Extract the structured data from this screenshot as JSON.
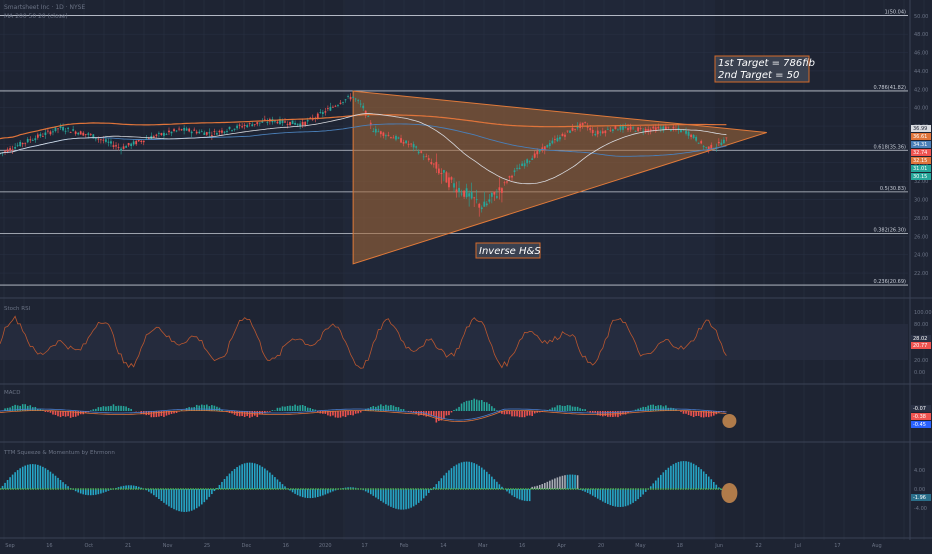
{
  "header": {
    "symbol_line": "Smartsheet Inc · 1D · NYSE",
    "ma_line": "MA 200 50 20 (close)"
  },
  "colors": {
    "background": "#1e2433",
    "grid": "#2a3245",
    "fib_line": "#c7ccd6",
    "triangle_fill": "#a86a36",
    "triangle_edge": "#e07a3a",
    "candle_up": "#26a69a",
    "candle_down": "#ef5350",
    "ma_orange": "#e0743a",
    "ma_white": "#d9dbe0",
    "ma_blue": "#4a7fb8",
    "annotation_border": "#d46a2a",
    "annotation_fill": "#3a4150",
    "highlight_circle": "#b07b4a"
  },
  "annotations": {
    "targets_line1": "1st Target = 786fib",
    "targets_line2": "2nd Target = 50",
    "pattern": "Inverse H&S"
  },
  "indicators": {
    "stoch_label": "Stoch RSI",
    "macd_label": "MACD",
    "ttm_label": "TTM Squeeze & Momentum by Ehrmonn"
  },
  "time_axis": [
    "Sep",
    "16",
    "Oct",
    "21",
    "Nov",
    "25",
    "Dec",
    "16",
    "2020",
    "17",
    "Feb",
    "14",
    "Mar",
    "16",
    "Apr",
    "20",
    "May",
    "18",
    "Jun",
    "22",
    "Jul",
    "17",
    "Aug"
  ],
  "chart_data": [
    {
      "type": "line",
      "title": "",
      "price_axis_ticks": [
        22,
        24,
        26,
        28,
        30,
        32,
        34,
        36,
        38,
        40,
        42,
        44,
        46,
        48,
        50,
        52
      ],
      "ylim": [
        19.5,
        51.5
      ],
      "fib_levels": [
        {
          "label": "1(50.04)",
          "value": 50.04
        },
        {
          "label": "0.786(41.82)",
          "value": 41.82
        },
        {
          "label": "0.618(35.36)",
          "value": 35.36
        },
        {
          "label": "0.5(30.83)",
          "value": 30.83
        },
        {
          "label": "0.382(26.30)",
          "value": 26.3
        },
        {
          "label": "0.236(20.69)",
          "value": 20.69
        }
      ],
      "price_badges": [
        "36.99",
        "36.61",
        "34.31",
        "32.74",
        "32.15",
        "31.01",
        "30.15"
      ],
      "price_path": [
        [
          0,
          35.0
        ],
        [
          6,
          36.5
        ],
        [
          12,
          37.8
        ],
        [
          18,
          37.0
        ],
        [
          24,
          35.6
        ],
        [
          30,
          36.8
        ],
        [
          36,
          37.6
        ],
        [
          42,
          37.2
        ],
        [
          48,
          38.0
        ],
        [
          54,
          38.6
        ],
        [
          60,
          38.2
        ],
        [
          64,
          39.4
        ],
        [
          68,
          40.8
        ],
        [
          70,
          41.2
        ],
        [
          72,
          40.0
        ],
        [
          74,
          37.6
        ],
        [
          78,
          36.8
        ],
        [
          82,
          35.8
        ],
        [
          86,
          33.8
        ],
        [
          89,
          32.0
        ],
        [
          92,
          30.8
        ],
        [
          95,
          29.5
        ],
        [
          96,
          29.2
        ],
        [
          99,
          31.0
        ],
        [
          102,
          33.0
        ],
        [
          106,
          34.8
        ],
        [
          110,
          36.4
        ],
        [
          114,
          37.8
        ],
        [
          116,
          38.2
        ],
        [
          118,
          37.2
        ],
        [
          122,
          37.8
        ],
        [
          128,
          37.6
        ],
        [
          132,
          37.8
        ],
        [
          136,
          37.4
        ],
        [
          138,
          36.6
        ],
        [
          140,
          35.6
        ],
        [
          142,
          35.8
        ],
        [
          143,
          36.2
        ],
        [
          144,
          36.5
        ]
      ],
      "triangle": {
        "apex": [
          152,
          37.3
        ],
        "top_left": [
          70,
          41.8
        ],
        "bottom_left": [
          70,
          23.0
        ]
      },
      "x_range": [
        0,
        180
      ]
    },
    {
      "type": "line",
      "title": "Stoch RSI",
      "y_ticks": [
        "100.00",
        "80.00",
        "20.00",
        "0.00"
      ],
      "values_labels": [
        "28.02",
        "20.77"
      ],
      "ylim": [
        0,
        100
      ]
    },
    {
      "type": "bar",
      "title": "MACD",
      "values_labels": [
        "-0.07",
        "-0.38",
        "-0.45"
      ]
    },
    {
      "type": "bar",
      "title": "TTM Squeeze & Momentum by Ehrmonn",
      "y_ticks": [
        "4.00",
        "0.00",
        "-4.00"
      ],
      "values_labels": [
        "-1.96"
      ]
    }
  ]
}
